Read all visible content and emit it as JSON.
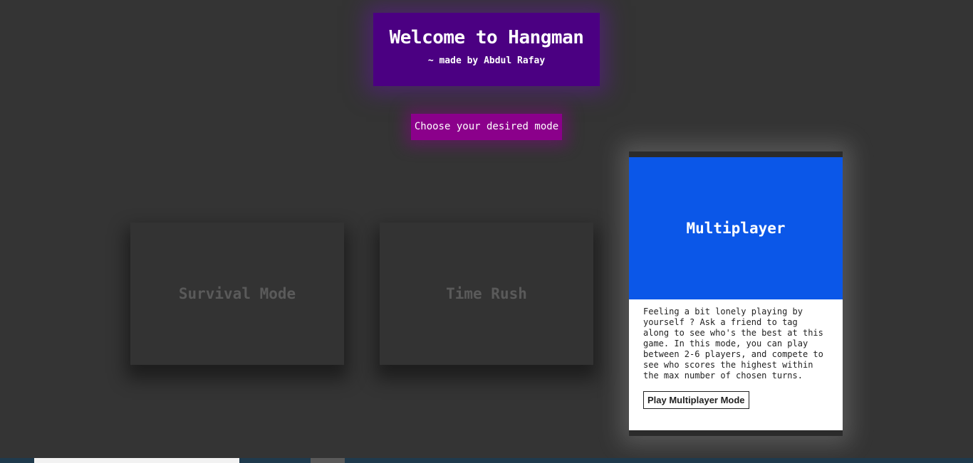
{
  "header": {
    "title": "Welcome to Hangman",
    "subtitle": "~ made by Abdul Rafay"
  },
  "mode_prompt": "Choose your desired mode",
  "modes": [
    {
      "title": "Survival Mode"
    },
    {
      "title": "Time Rush"
    },
    {
      "title": "Multiplayer",
      "description": "Feeling a bit lonely playing by yourself ? Ask a friend to tag along to see who's the best at this game. In this mode, you can play between 2-6 players, and compete to see who scores the highest within the max number of chosen turns.",
      "button_label": "Play Multiplayer Mode"
    }
  ],
  "colors": {
    "background": "#343434",
    "header_bg": "#4b0082",
    "prompt_bg": "#8b008b",
    "active_banner": "#0b57e8"
  }
}
